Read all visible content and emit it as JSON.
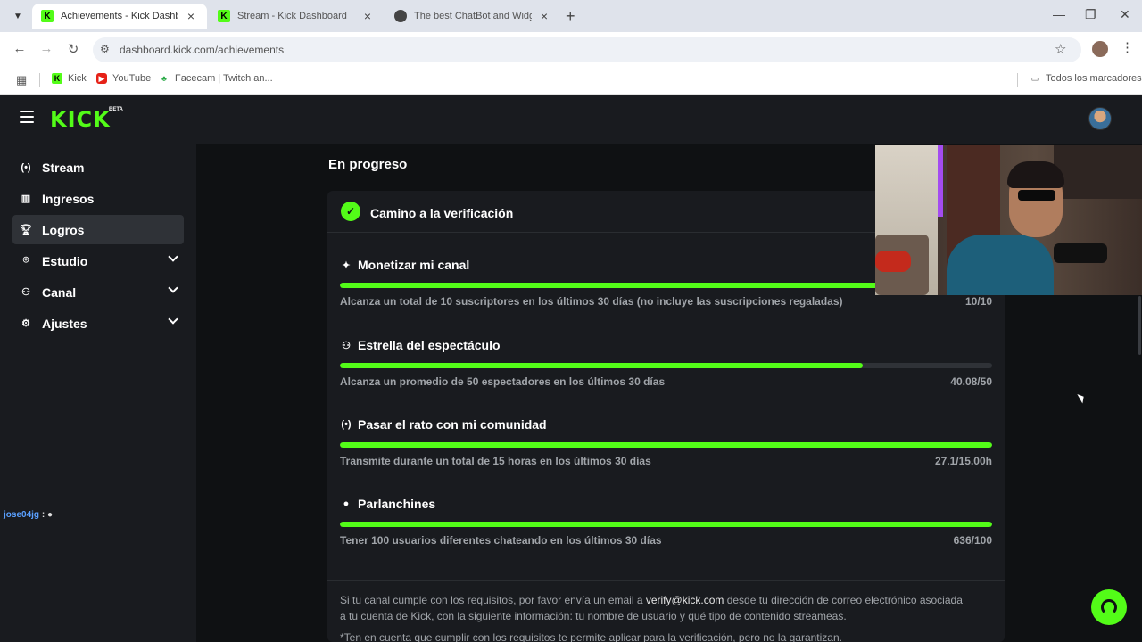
{
  "browser": {
    "tabs": [
      {
        "label": "Achievements - Kick Dashboard",
        "active": true
      },
      {
        "label": "Stream - Kick Dashboard",
        "active": false
      },
      {
        "label": "The best ChatBot and Widgets f",
        "active": false
      }
    ],
    "url": "dashboard.kick.com/achievements",
    "bookmarks": [
      {
        "label": "Kick",
        "icon": "kick-icon"
      },
      {
        "label": "YouTube",
        "icon": "youtube-icon"
      },
      {
        "label": "Facecam | Twitch an...",
        "icon": "facecam-icon"
      }
    ],
    "all_bookmarks_label": "Todos los marcadores"
  },
  "header": {
    "logo_text": "KICK",
    "logo_badge": "BETA"
  },
  "sidebar": {
    "items": [
      {
        "label": "Stream",
        "icon": "broadcast-icon",
        "active": false,
        "expandable": false
      },
      {
        "label": "Ingresos",
        "icon": "chart-icon",
        "active": false,
        "expandable": false
      },
      {
        "label": "Logros",
        "icon": "trophy-icon",
        "active": true,
        "expandable": false
      },
      {
        "label": "Estudio",
        "icon": "studio-icon",
        "active": false,
        "expandable": true
      },
      {
        "label": "Canal",
        "icon": "users-icon",
        "active": false,
        "expandable": true
      },
      {
        "label": "Ajustes",
        "icon": "gear-icon",
        "active": false,
        "expandable": true
      }
    ]
  },
  "chat": {
    "user": "jose04jg",
    "separator": ":"
  },
  "main": {
    "section_title": "En progreso",
    "card": {
      "title": "Camino a la verificación",
      "requirements": [
        {
          "title": "Monetizar mi canal",
          "icon": "sparkle-icon",
          "description": "Alcanza un total de 10 suscriptores en los últimos 30 días (no incluye las suscripciones regaladas)",
          "value": "10/10",
          "progress": 1.0
        },
        {
          "title": "Estrella del espectáculo",
          "icon": "users-icon",
          "description": "Alcanza un promedio de 50 espectadores en los últimos 30 días",
          "value": "40.08/50",
          "progress": 0.8016
        },
        {
          "title": "Pasar el rato con mi comunidad",
          "icon": "broadcast-icon",
          "description": "Transmite durante un total de 15 horas en los últimos 30 días",
          "value": "27.1/15.00h",
          "progress": 1.0
        },
        {
          "title": "Parlanchines",
          "icon": "chat-icon",
          "description": "Tener 100 usuarios diferentes chateando en los últimos 30 días",
          "value": "636/100",
          "progress": 1.0
        }
      ],
      "note_before_link": "Si tu canal cumple con los requisitos, por favor envía un email a ",
      "note_link": "verify@kick.com",
      "note_after_link": " desde tu dirección de correo electrónico asociada a tu cuenta de Kick, con la siguiente información: tu nombre de usuario y qué tipo de contenido streameas.",
      "note_disclaimer": "*Ten en cuenta que cumplir con los requisitos te permite aplicar para la verificación, pero no la garantizan."
    }
  },
  "colors": {
    "accent": "#53fc18",
    "bg_main": "#0f1113",
    "bg_panel": "#191b1f"
  }
}
